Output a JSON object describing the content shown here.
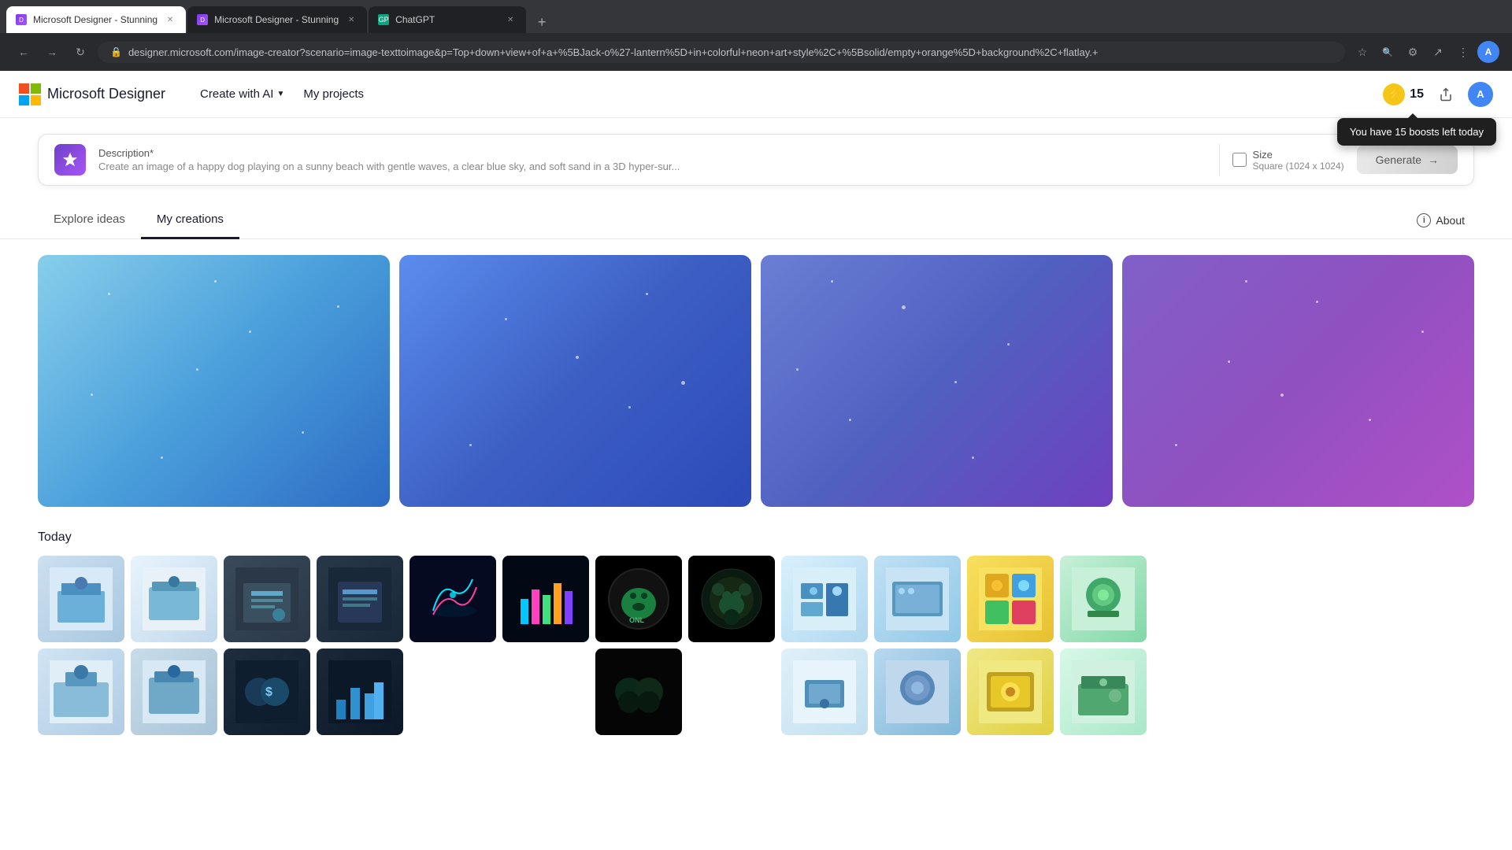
{
  "browser": {
    "tabs": [
      {
        "id": "tab1",
        "title": "Microsoft Designer - Stunning",
        "active": true,
        "favicon_color": "#7c3aed"
      },
      {
        "id": "tab2",
        "title": "Microsoft Designer - Stunning",
        "active": false,
        "favicon_color": "#7c3aed"
      },
      {
        "id": "tab3",
        "title": "ChatGPT",
        "active": false,
        "favicon_color": "#10a37f"
      }
    ],
    "url": "designer.microsoft.com/image-creator?scenario=image-texttoimage&p=Top+down+view+of+a+%5BJack-o%27-lantern%5D+in+colorful+neon+art+style%2C+%5Bsolid/empty+orange%5D+background%2C+flatlay.+"
  },
  "header": {
    "logo_text": "Microsoft Designer",
    "create_with_ai_label": "Create with AI",
    "my_projects_label": "My projects",
    "boost_count": "15",
    "boost_tooltip": "You have 15 boosts left today"
  },
  "prompt": {
    "label": "Description*",
    "placeholder": "Create an image of a happy dog playing on a sunny beach with gentle waves, a clear blue sky, and soft sand in a 3D hyper-sur...",
    "size_label": "Size",
    "size_value": "Square (1024 x 1024)",
    "generate_label": "Generate"
  },
  "tabs": {
    "explore_ideas_label": "Explore ideas",
    "my_creations_label": "My creations",
    "about_label": "About",
    "active_tab": "my_creations"
  },
  "loading_images": [
    {
      "id": "img1",
      "gradient": "loading-image-1"
    },
    {
      "id": "img2",
      "gradient": "loading-image-2"
    },
    {
      "id": "img3",
      "gradient": "loading-image-3"
    },
    {
      "id": "img4",
      "gradient": "loading-image-4"
    }
  ],
  "today": {
    "label": "Today",
    "groups": [
      {
        "id": "g1",
        "colors": [
          "#c5d8e8",
          "#aac5d8"
        ],
        "type": "office"
      },
      {
        "id": "g2",
        "colors": [
          "#b8d0e0",
          "#8ab5c8"
        ],
        "type": "office2"
      },
      {
        "id": "g3",
        "colors": [
          "#3a4a5a",
          "#2a3a4a"
        ],
        "type": "dark-office"
      },
      {
        "id": "g4",
        "colors": [
          "#1a2535",
          "#252f3f"
        ],
        "type": "dark-office2"
      },
      {
        "id": "g5",
        "colors": [
          "#050a20",
          "#08102a"
        ],
        "type": "dark-chart"
      },
      {
        "id": "g6",
        "colors": [
          "#000000",
          "#0a0a0a"
        ],
        "type": "black-dog"
      },
      {
        "id": "g7",
        "colors": [
          "#e0eff8",
          "#c0d8e8"
        ],
        "type": "light-tech"
      },
      {
        "id": "g8",
        "colors": [
          "#a8d8f0",
          "#78b8d8"
        ],
        "type": "teal-tech"
      },
      {
        "id": "g9",
        "colors": [
          "#f8e070",
          "#e8c828"
        ],
        "type": "yellow"
      },
      {
        "id": "g10",
        "colors": [
          "#c8f0e0",
          "#80d8b0"
        ],
        "type": "green"
      }
    ]
  }
}
